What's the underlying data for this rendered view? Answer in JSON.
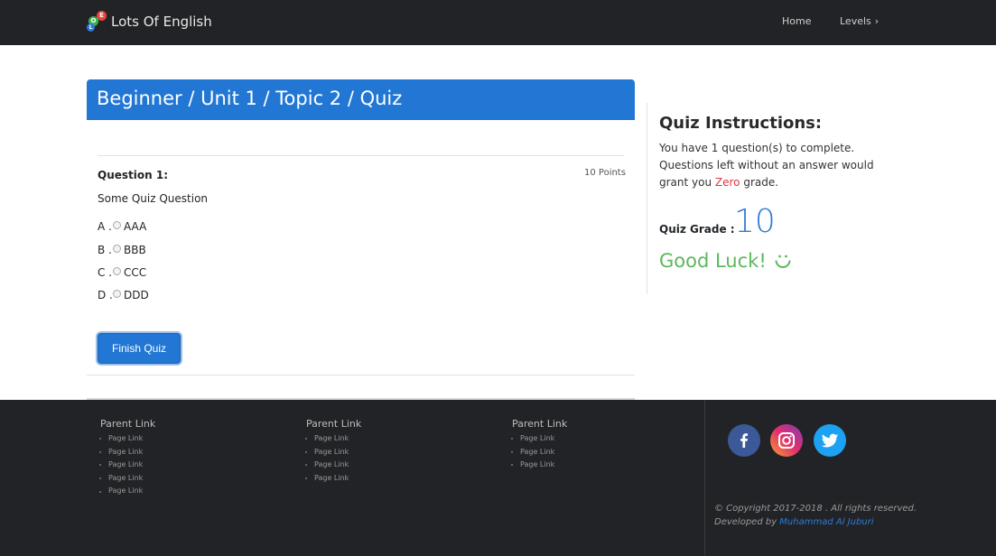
{
  "navbar": {
    "brand_logo_letters": {
      "o": "O",
      "e": "E",
      "l": "L"
    },
    "brand": "Lots Of English",
    "links": [
      {
        "label": "Home"
      },
      {
        "label": "Levels",
        "icon": "chevron-right-icon"
      }
    ]
  },
  "quiz": {
    "title": "Beginner / Unit 1 / Topic 2 / Quiz",
    "question_label": "Question 1:",
    "points": "10 Points",
    "question_text": "Some Quiz Question",
    "options": [
      {
        "letter": "A .",
        "text": "AAA"
      },
      {
        "letter": "B .",
        "text": "BBB"
      },
      {
        "letter": "C .",
        "text": "CCC"
      },
      {
        "letter": "D .",
        "text": "DDD"
      }
    ],
    "finish_label": "Finish Quiz"
  },
  "sidebar": {
    "title": "Quiz Instructions:",
    "instructions_part1": "You have 1 question(s) to complete. Questions left without an answer would grant you ",
    "zero_word": "Zero",
    "instructions_part2": " grade.",
    "grade_label": "Quiz Grade :",
    "grade_value": "10",
    "good_luck": "Good Luck!"
  },
  "footer": {
    "columns": [
      {
        "parent": "Parent Link",
        "links": [
          "Page Link",
          "Page Link",
          "Page Link",
          "Page Link",
          "Page Link"
        ]
      },
      {
        "parent": "Parent Link",
        "links": [
          "Page Link",
          "Page Link",
          "Page Link",
          "Page Link"
        ]
      },
      {
        "parent": "Parent Link",
        "links": [
          "Page Link",
          "Page Link",
          "Page Link"
        ]
      }
    ],
    "social": [
      "facebook-icon",
      "instagram-icon",
      "twitter-icon"
    ],
    "copyright": "© Copyright 2017-2018 . All rights reserved.",
    "developed_by": "Developed by ",
    "developer_name": "Muhammad Al Juburi"
  },
  "colors": {
    "navbar_bg": "#222326",
    "accent": "#2277d4",
    "success": "#5cb85c",
    "danger": "#dc3545"
  }
}
